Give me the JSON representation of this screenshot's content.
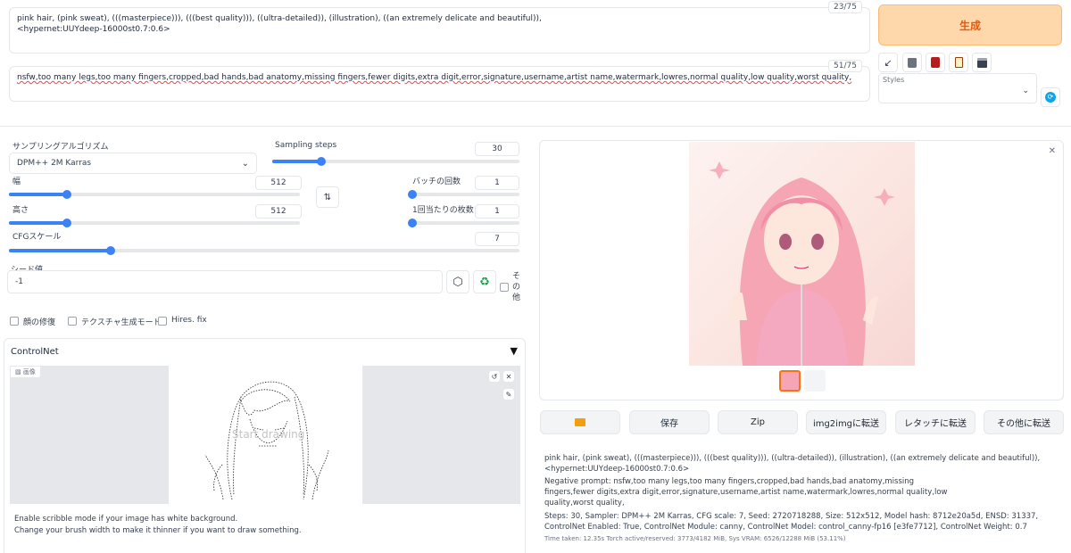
{
  "prompt": {
    "text": "pink hair, (pink sweat), (((masterpiece))), (((best quality))), ((ultra-detailed)), (illustration), ((an extremely delicate and beautiful)),\n<hypernet:UUYdeep-16000st0.7:0.6>",
    "counter": "23/75"
  },
  "negative_prompt": {
    "text": "nsfw,too many legs,too many fingers,cropped,bad hands,bad anatomy,missing fingers,fewer digits,extra digit,error,signature,username,artist name,watermark,lowres,normal quality,low quality,worst quality,",
    "counter": "51/75"
  },
  "generate_label": "生成",
  "styles": {
    "label": "Styles",
    "value": ""
  },
  "settings": {
    "sampler_label": "サンプリングアルゴリズム",
    "sampler_value": "DPM++ 2M Karras",
    "steps_label": "Sampling steps",
    "steps_value": "30",
    "steps_fraction": 0.2,
    "width_label": "幅",
    "width_value": "512",
    "width_fraction": 0.2,
    "height_label": "高さ",
    "height_value": "512",
    "height_fraction": 0.2,
    "batch_count_label": "バッチの回数",
    "batch_count_value": "1",
    "batch_count_fraction": 0.0,
    "batch_size_label": "1回当たりの枚数",
    "batch_size_value": "1",
    "batch_size_fraction": 0.0,
    "cfg_label": "CFGスケール",
    "cfg_value": "7",
    "cfg_fraction": 0.2,
    "seed_label": "シード値",
    "seed_value": "-1",
    "extra_label": "その他"
  },
  "checkboxes": [
    {
      "label": "顔の修復"
    },
    {
      "label": "テクスチャ生成モード"
    },
    {
      "label": "Hires. fix"
    }
  ],
  "controlnet": {
    "title": "ControlNet",
    "image_label": "画像",
    "canvas_hint": "Start drawing",
    "note1": "Enable scribble mode if your image has white background.",
    "note2": "Change your brush width to make it thinner if you want to draw something."
  },
  "output": {
    "buttons": [
      "保存",
      "Zip",
      "img2imgに転送",
      "レタッチに転送",
      "その他に転送"
    ],
    "info_prompt": "pink hair, (pink sweat), (((masterpiece))), (((best quality))), ((ultra-detailed)), (illustration), ((an extremely delicate and beautiful)),\n<hypernet:UUYdeep-16000st0.7:0.6>",
    "info_negative": "Negative prompt: nsfw,too many legs,too many fingers,cropped,bad hands,bad anatomy,missing fingers,fewer digits,extra digit,error,signature,username,artist name,watermark,lowres,normal quality,low quality,worst quality,",
    "info_params": "Steps: 30, Sampler: DPM++ 2M Karras, CFG scale: 7, Seed: 2720718288, Size: 512x512, Model hash: 8712e20a5d, ENSD: 31337, ControlNet Enabled: True, ControlNet Module: canny, ControlNet Model: control_canny-fp16 [e3fe7712], ControlNet Weight: 0.7",
    "timing": "Time taken: 12.35s  Torch active/reserved: 3773/4182 MiB, Sys VRAM: 6526/12288 MiB (53.11%)"
  },
  "colors": {
    "accent": "#3b82f6",
    "generate_bg": "#fed7aa",
    "generate_text": "#ea580c"
  }
}
